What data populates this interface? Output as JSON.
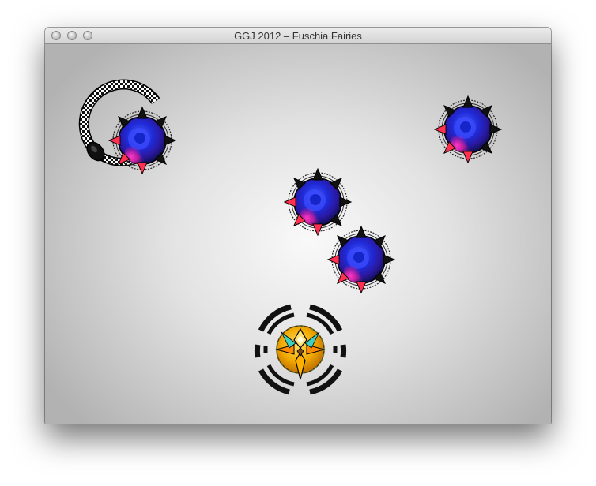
{
  "window": {
    "title": "GGJ 2012 – Fuschia Fairies",
    "controls": [
      "close-button",
      "minimize-button",
      "zoom-button"
    ]
  },
  "game": {
    "enemies": [
      {
        "name": "spiked-orb-enemy-1",
        "icon": "spiked-orb-icon"
      },
      {
        "name": "spiked-orb-enemy-2",
        "icon": "spiked-orb-icon"
      },
      {
        "name": "spiked-orb-enemy-3",
        "icon": "spiked-orb-icon"
      },
      {
        "name": "spiked-orb-enemy-4",
        "icon": "spiked-orb-icon"
      }
    ],
    "serpent": {
      "icon": "checkered-serpent-icon"
    },
    "player": {
      "icon": "fairy-player-icon",
      "shield_icon": "segmented-shield-ring-icon"
    },
    "colors": {
      "enemy_core": "#2030ff",
      "enemy_glow": "#ff20c0",
      "player_core": "#f0b000",
      "shield": "#111111"
    }
  }
}
